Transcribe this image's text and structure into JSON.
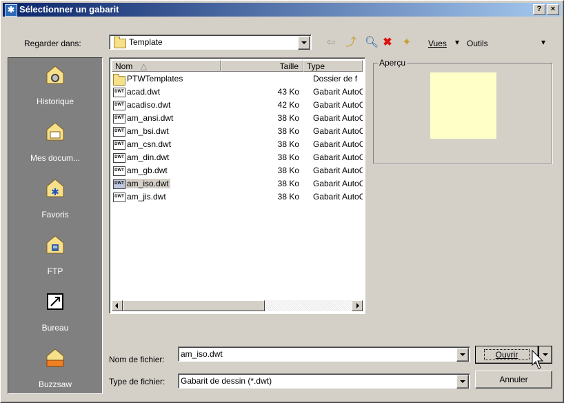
{
  "window": {
    "title": "Sélectionner un gabarit"
  },
  "titlebar_buttons": {
    "help": "?",
    "close": "×"
  },
  "lookin": {
    "label": "Regarder dans:",
    "value": "Template"
  },
  "toolbar": {
    "views_label": "Vues",
    "tools_label": "Outils"
  },
  "places": [
    {
      "label": "Historique",
      "icon": "history-icon"
    },
    {
      "label": "Mes docum...",
      "icon": "my-documents-icon"
    },
    {
      "label": "Favoris",
      "icon": "favorites-icon"
    },
    {
      "label": "FTP",
      "icon": "ftp-icon"
    },
    {
      "label": "Bureau",
      "icon": "desktop-icon"
    },
    {
      "label": "Buzzsaw",
      "icon": "buzzsaw-icon"
    }
  ],
  "columns": {
    "name": "Nom",
    "size": "Taille",
    "type": "Type"
  },
  "files": [
    {
      "name": "PTWTemplates",
      "size": "",
      "type": "Dossier de f",
      "kind": "folder"
    },
    {
      "name": "acad.dwt",
      "size": "43 Ko",
      "type": "Gabarit AutoCAD",
      "kind": "dwt"
    },
    {
      "name": "acadiso.dwt",
      "size": "42 Ko",
      "type": "Gabarit AutoCAD",
      "kind": "dwt"
    },
    {
      "name": "am_ansi.dwt",
      "size": "38 Ko",
      "type": "Gabarit AutoCAD",
      "kind": "dwt"
    },
    {
      "name": "am_bsi.dwt",
      "size": "38 Ko",
      "type": "Gabarit AutoCAD",
      "kind": "dwt"
    },
    {
      "name": "am_csn.dwt",
      "size": "38 Ko",
      "type": "Gabarit AutoCAD",
      "kind": "dwt"
    },
    {
      "name": "am_din.dwt",
      "size": "38 Ko",
      "type": "Gabarit AutoCAD",
      "kind": "dwt"
    },
    {
      "name": "am_gb.dwt",
      "size": "38 Ko",
      "type": "Gabarit AutoCAD",
      "kind": "dwt"
    },
    {
      "name": "am_iso.dwt",
      "size": "38 Ko",
      "type": "Gabarit AutoCAD",
      "kind": "dwt",
      "selected": true
    },
    {
      "name": "am_jis.dwt",
      "size": "38 Ko",
      "type": "Gabarit AutoCAD",
      "kind": "dwt"
    }
  ],
  "preview": {
    "label": "Aperçu",
    "color": "#ffffc8"
  },
  "filename": {
    "label": "Nom de fichier:",
    "value": "am_iso.dwt"
  },
  "filetype": {
    "label": "Type de fichier:",
    "value": "Gabarit de dessin (*.dwt)"
  },
  "buttons": {
    "open": "Ouvrir",
    "cancel": "Annuler"
  },
  "colors": {
    "title_start": "#0a246a",
    "title_end": "#a6caf0",
    "places_bg": "#808080"
  }
}
